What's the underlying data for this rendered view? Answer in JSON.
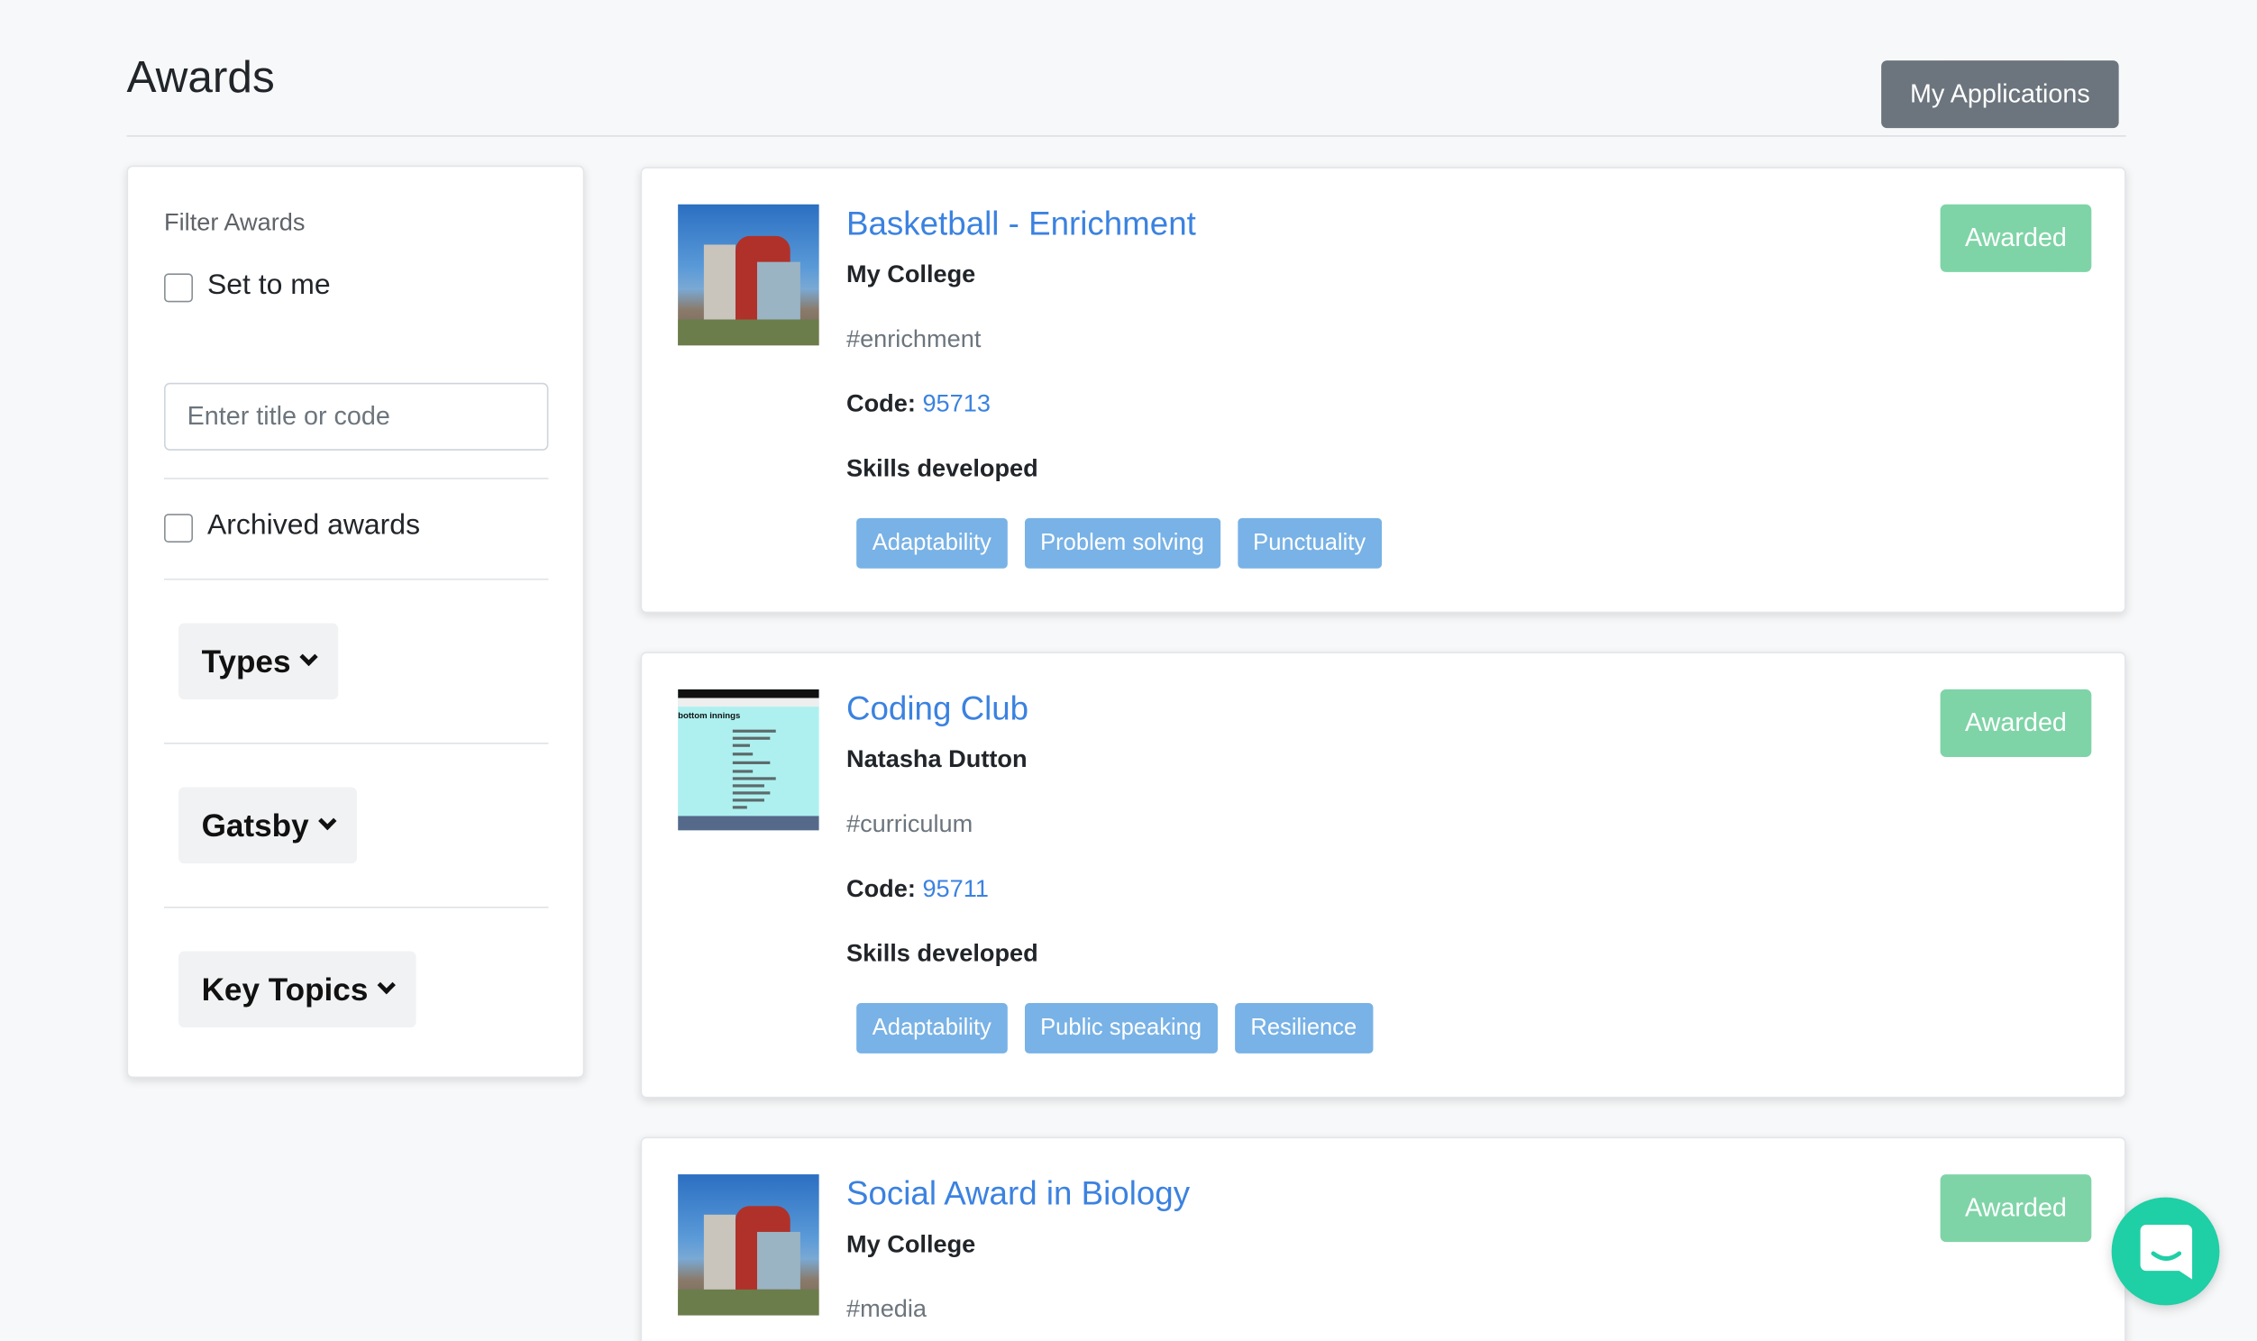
{
  "page": {
    "title": "Awards"
  },
  "header": {
    "my_applications_label": "My Applications"
  },
  "filters": {
    "heading": "Filter Awards",
    "set_to_me_label": "Set to me",
    "search_placeholder": "Enter title or code",
    "archived_label": "Archived awards",
    "dropdowns": [
      {
        "label": "Types"
      },
      {
        "label": "Gatsby"
      },
      {
        "label": "Key Topics"
      }
    ]
  },
  "awards": [
    {
      "title": "Basketball - Enrichment",
      "owner": "My College",
      "tag": "#enrichment",
      "code_label": "Code:",
      "code": "95713",
      "skills_heading": "Skills developed",
      "skills": [
        "Adaptability",
        "Problem solving",
        "Punctuality"
      ],
      "status": "Awarded",
      "thumbnail": "college-building-image"
    },
    {
      "title": "Coding Club",
      "owner": "Natasha Dutton",
      "tag": "#curriculum",
      "code_label": "Code:",
      "code": "95711",
      "skills_heading": "Skills developed",
      "skills": [
        "Adaptability",
        "Public speaking",
        "Resilience"
      ],
      "status": "Awarded",
      "thumbnail": "phone-screenshot-image",
      "thumbnail_text": "bottom innings"
    },
    {
      "title": "Social Award in Biology",
      "owner": "My College",
      "tag": "#media",
      "status": "Awarded",
      "thumbnail": "college-building-image"
    }
  ],
  "colors": {
    "link": "#3b82e0",
    "skill_badge": "#78b2e6",
    "status_badge": "#7fd4a7",
    "secondary_button": "#6c757d",
    "chat": "#1fcfa6"
  },
  "icons": {
    "chat": "chat-bubble-icon",
    "dropdown": "chevron-down-icon"
  }
}
